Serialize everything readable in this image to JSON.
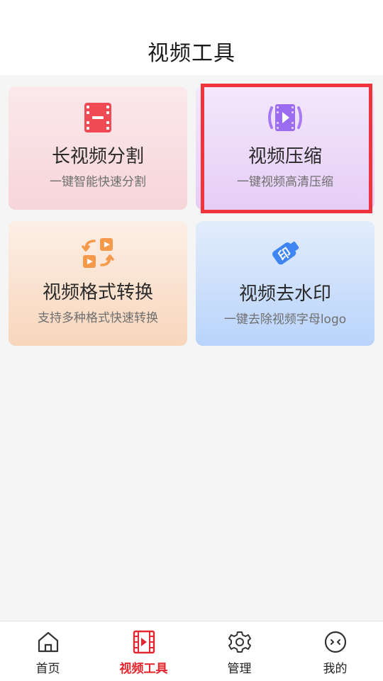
{
  "header": {
    "title": "视频工具"
  },
  "tools": [
    {
      "title": "长视频分割",
      "subtitle": "一键智能快速分割",
      "icon": "film-split-icon"
    },
    {
      "title": "视频压缩",
      "subtitle": "一键视频高清压缩",
      "icon": "video-compress-icon"
    },
    {
      "title": "视频格式转换",
      "subtitle": "支持多种格式快速转换",
      "icon": "format-convert-icon"
    },
    {
      "title": "视频去水印",
      "subtitle": "一键去除视频字母logo",
      "icon": "watermark-eraser-icon"
    }
  ],
  "tabbar": {
    "active": "视频工具",
    "items": [
      {
        "label": "首页",
        "icon": "home-icon"
      },
      {
        "label": "视频工具",
        "icon": "film-icon"
      },
      {
        "label": "管理",
        "icon": "gear-icon"
      },
      {
        "label": "我的",
        "icon": "face-icon"
      }
    ]
  },
  "colors": {
    "accent": "#e3262f",
    "highlight": "#f0343d",
    "split": "#f04b55",
    "compress": "#9b6cf0",
    "convert": "#f59a4a",
    "watermark": "#3f86f2"
  }
}
